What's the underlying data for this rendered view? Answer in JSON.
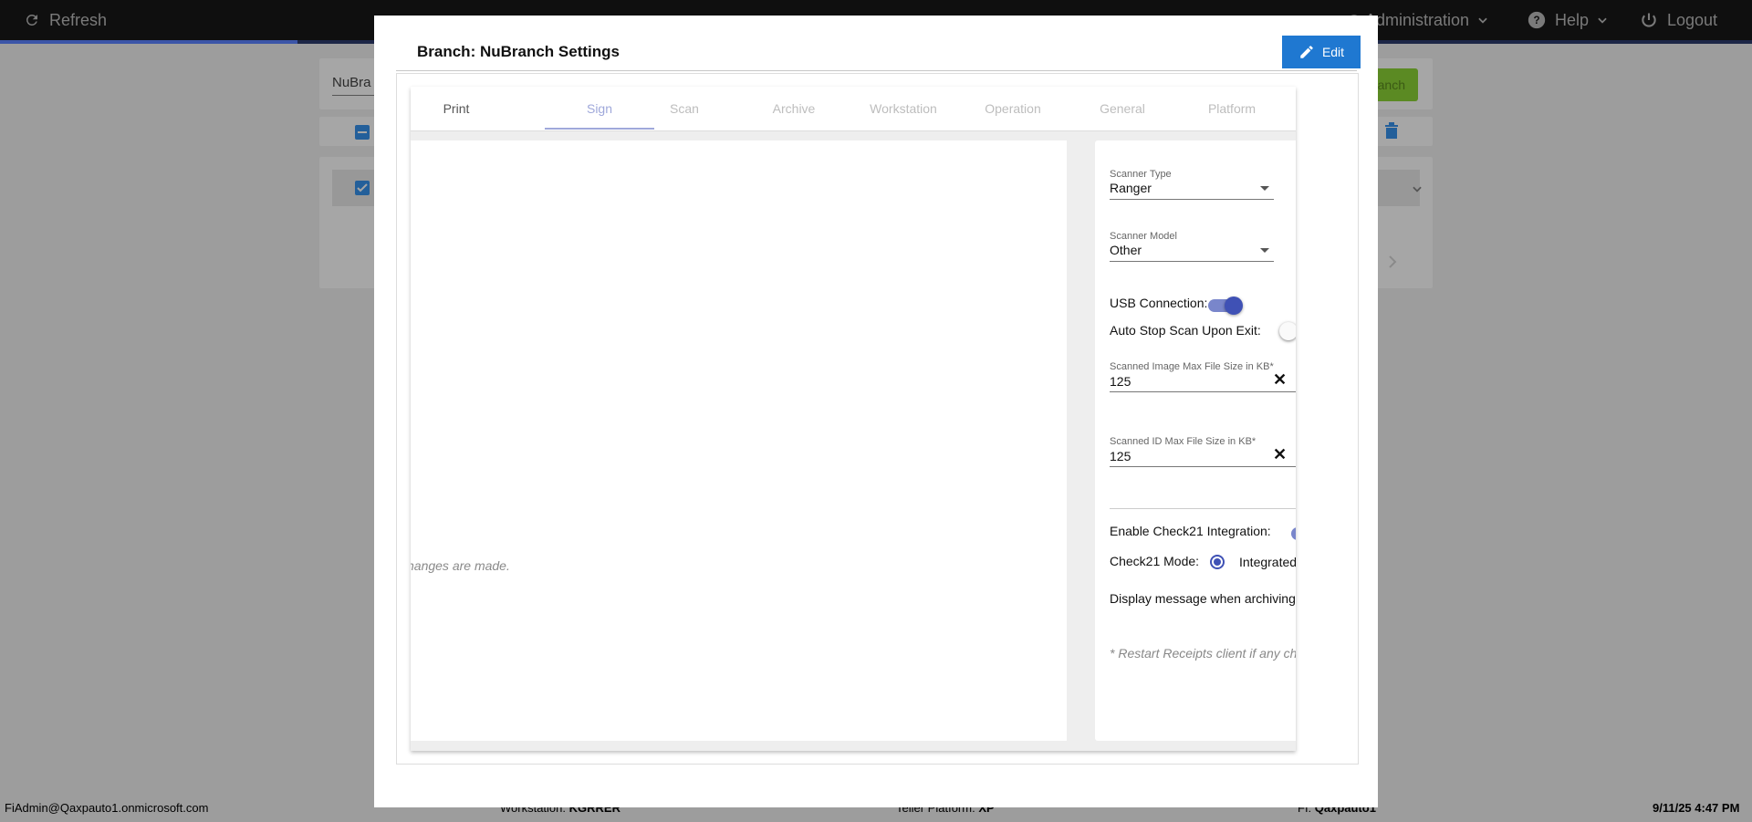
{
  "topbar": {
    "refresh_label": "Refresh",
    "administration_label": "Administration",
    "help_label": "Help",
    "logout_label": "Logout",
    "progress_fraction": 0.17
  },
  "background": {
    "branch_field_value": "NuBra",
    "add_branch_label": "anch"
  },
  "footer": {
    "user": "FiAdmin@Qaxpauto1.onmicrosoft.com",
    "workstation_label": "Workstation:",
    "workstation_value": "KGRRER",
    "platform_label": "Teller Platform:",
    "platform_value": "XP",
    "fi_label": "FI:",
    "fi_value": "Qaxpauto1",
    "datetime": "9/11/25 4:47 PM"
  },
  "modal": {
    "title": "Branch: NuBranch Settings",
    "edit_label": "Edit",
    "tabs": [
      {
        "label": "Print"
      },
      {
        "label": "Sign"
      },
      {
        "label": "Scan"
      },
      {
        "label": "Archive"
      },
      {
        "label": "Workstation"
      },
      {
        "label": "Operation"
      },
      {
        "label": "General"
      },
      {
        "label": "Platform"
      }
    ],
    "active_tab": "Sign",
    "left_note": "hanges are made.",
    "scan": {
      "scanner_type_label": "Scanner Type",
      "scanner_type_value": "Ranger",
      "scanner_model_label": "Scanner Model",
      "scanner_model_value": "Other",
      "usb_label": "USB Connection:",
      "usb_on": true,
      "auto_stop_label": "Auto Stop Scan Upon Exit:",
      "auto_stop_on": false,
      "image_max_label": "Scanned Image Max File Size in KB*",
      "image_max_value": "125",
      "id_max_label": "Scanned ID Max File Size in KB*",
      "id_max_value": "125",
      "check21_label": "Enable Check21 Integration:",
      "check21_mode_label": "Check21 Mode:",
      "check21_mode_value": "Integrated",
      "display_msg_label": "Display message when archiving",
      "restart_note": "* Restart Receipts client if any ch"
    }
  },
  "colors": {
    "accent": "#3f51b5",
    "edit_button": "#1f78d1",
    "topbar": "#0f0f0f"
  }
}
